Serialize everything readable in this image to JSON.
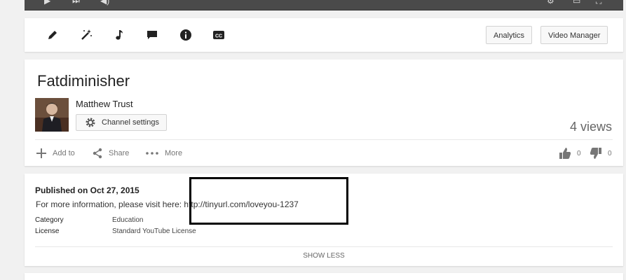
{
  "player": {
    "controls": [
      "play-icon",
      "next-icon",
      "volume-icon",
      "settings-icon",
      "theater-icon",
      "fullscreen-icon"
    ]
  },
  "toolbar": {
    "icons": [
      "pencil-icon",
      "magic-wand-icon",
      "music-note-icon",
      "comment-icon",
      "info-icon",
      "cc-icon"
    ],
    "analytics_label": "Analytics",
    "video_manager_label": "Video Manager"
  },
  "video": {
    "title": "Fatdiminisher",
    "owner": "Matthew Trust",
    "channel_settings_label": "Channel settings",
    "views": "4 views",
    "actions": {
      "add_to": "Add to",
      "share": "Share",
      "more": "More"
    },
    "likes": "0",
    "dislikes": "0"
  },
  "description": {
    "published": "Published on Oct 27, 2015",
    "text": "For more information, please visit here: http://tinyurl.com/loveyou-1237",
    "meta": [
      {
        "label": "Category",
        "value": "Education"
      },
      {
        "label": "License",
        "value": "Standard YouTube License"
      }
    ],
    "show_less_label": "SHOW LESS"
  },
  "colors": {
    "background": "#f1f1f1",
    "card": "#ffffff",
    "annotation_border": "#000000"
  }
}
